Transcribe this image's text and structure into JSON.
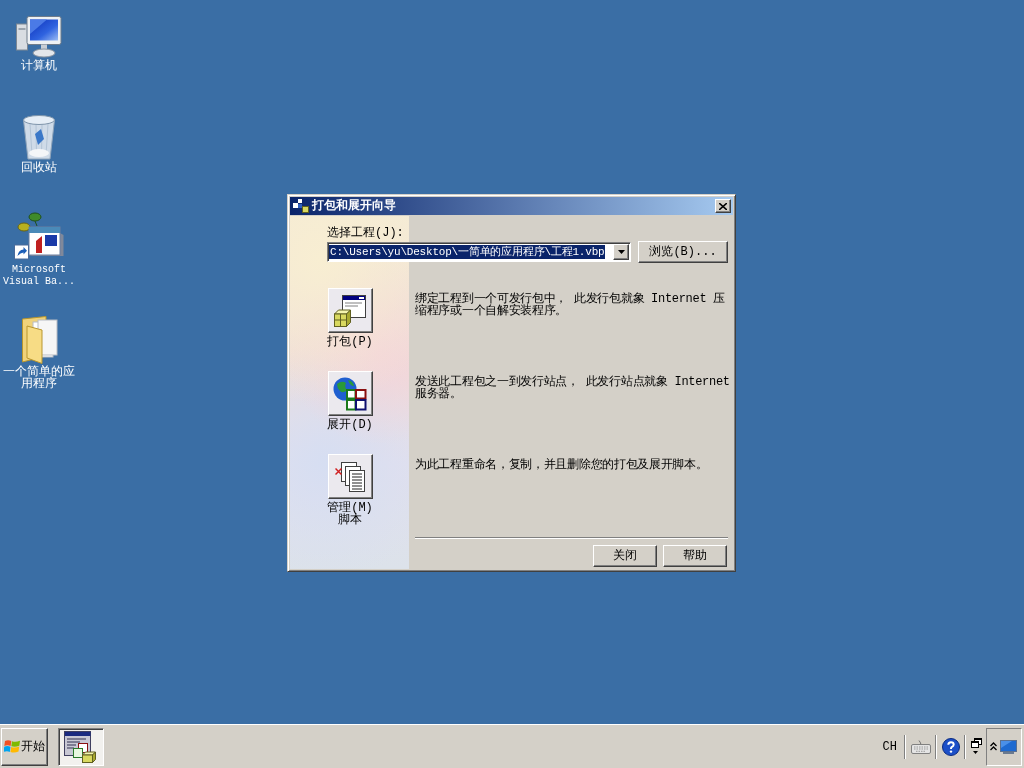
{
  "desktop_icons": [
    {
      "kind": "computer",
      "label": "计算机"
    },
    {
      "kind": "recycle_bin",
      "label": "回收站"
    },
    {
      "kind": "app_shortcut",
      "label": "Microsoft Visual Ba..."
    },
    {
      "kind": "folder",
      "label": "一个简单的应用程序"
    }
  ],
  "dialog": {
    "title": "打包和展开向导",
    "project_label": "选择工程(J):",
    "project_field": {
      "value": "C:\\Users\\yu\\Desktop\\一简单的应用程序\\工程1.vbp",
      "highlighted": true
    },
    "browse_button": "浏览(B)...",
    "options": [
      {
        "kind": "package",
        "label": "打包(P)",
        "description": "绑定工程到一个可发行包中， 此发行包就象 Internet 压缩程序或一个自解安装程序。"
      },
      {
        "kind": "deploy",
        "label": "展开(D)",
        "description": "发送此工程包之一到发行站点， 此发行站点就象 Internet 服务器。"
      },
      {
        "kind": "manage",
        "label": "管理(M)脚本",
        "description": "为此工程重命名，复制，并且删除您的打包及展开脚本。"
      }
    ],
    "buttons": [
      "关闭",
      "帮助"
    ]
  },
  "taskbar": {
    "start_label": "开始",
    "task_buttons": [
      {
        "pressed": true
      }
    ],
    "language": "CH"
  }
}
